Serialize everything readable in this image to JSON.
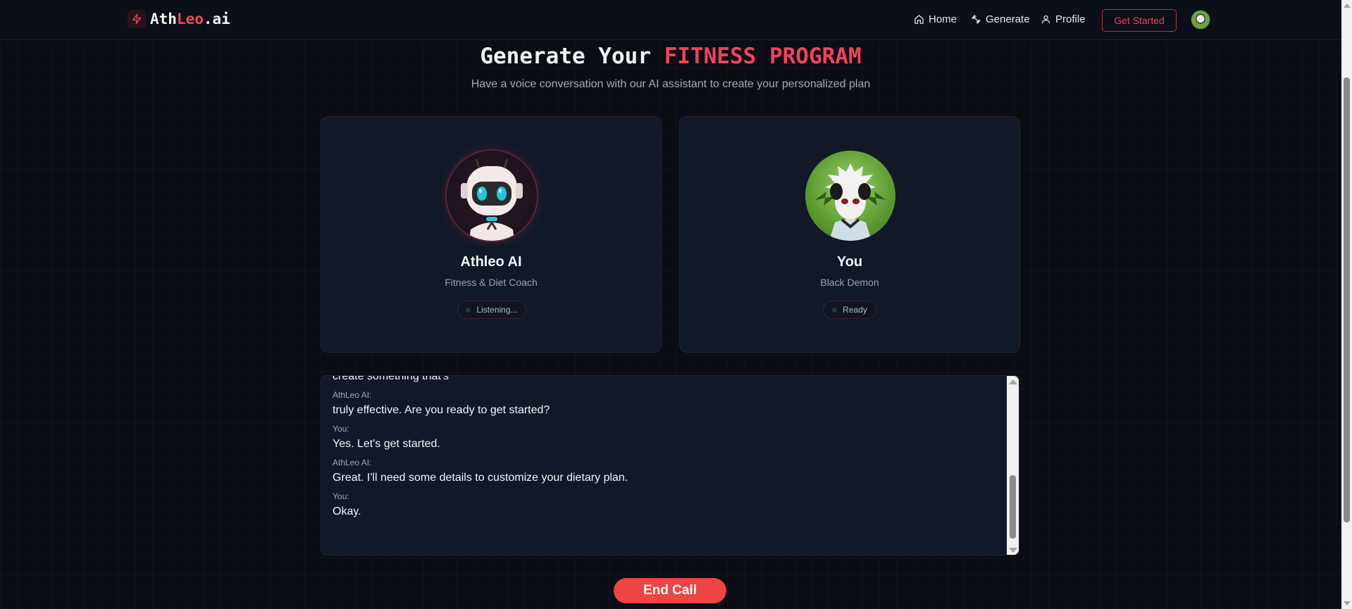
{
  "nav": {
    "logo_prefix": "Ath",
    "logo_accent": "Leo",
    "logo_suffix": ".ai",
    "logo_icon": "lightning-bolt-icon",
    "links": [
      {
        "label": "Home",
        "icon": "home-icon"
      },
      {
        "label": "Generate",
        "icon": "dumbbell-icon"
      },
      {
        "label": "Profile",
        "icon": "user-icon"
      }
    ],
    "cta_label": "Get Started",
    "avatar": "user-avatar"
  },
  "header": {
    "title_main": "Generate Your",
    "title_accent": "FITNESS PROGRAM",
    "subtitle": "Have a voice conversation with our AI assistant to create your personalized plan"
  },
  "ai_card": {
    "name": "Athleo AI",
    "role": "Fitness & Diet Coach",
    "status": "Listening..."
  },
  "user_card": {
    "name": "You",
    "role": "Black Demon",
    "status": "Ready"
  },
  "transcript": {
    "partial_text": "create something that's",
    "messages": [
      {
        "speaker": "AthLeo AI:",
        "text": "truly effective. Are you ready to get started?"
      },
      {
        "speaker": "You:",
        "text": "Yes. Let's get started."
      },
      {
        "speaker": "AthLeo AI:",
        "text": "Great. I'll need some details to customize your dietary plan."
      },
      {
        "speaker": "You:",
        "text": "Okay."
      }
    ]
  },
  "actions": {
    "end_call_label": "End Call"
  },
  "colors": {
    "accent": "#f0435a",
    "background": "#0a0d14",
    "card": "#111827",
    "end_call": "#ef4444"
  }
}
